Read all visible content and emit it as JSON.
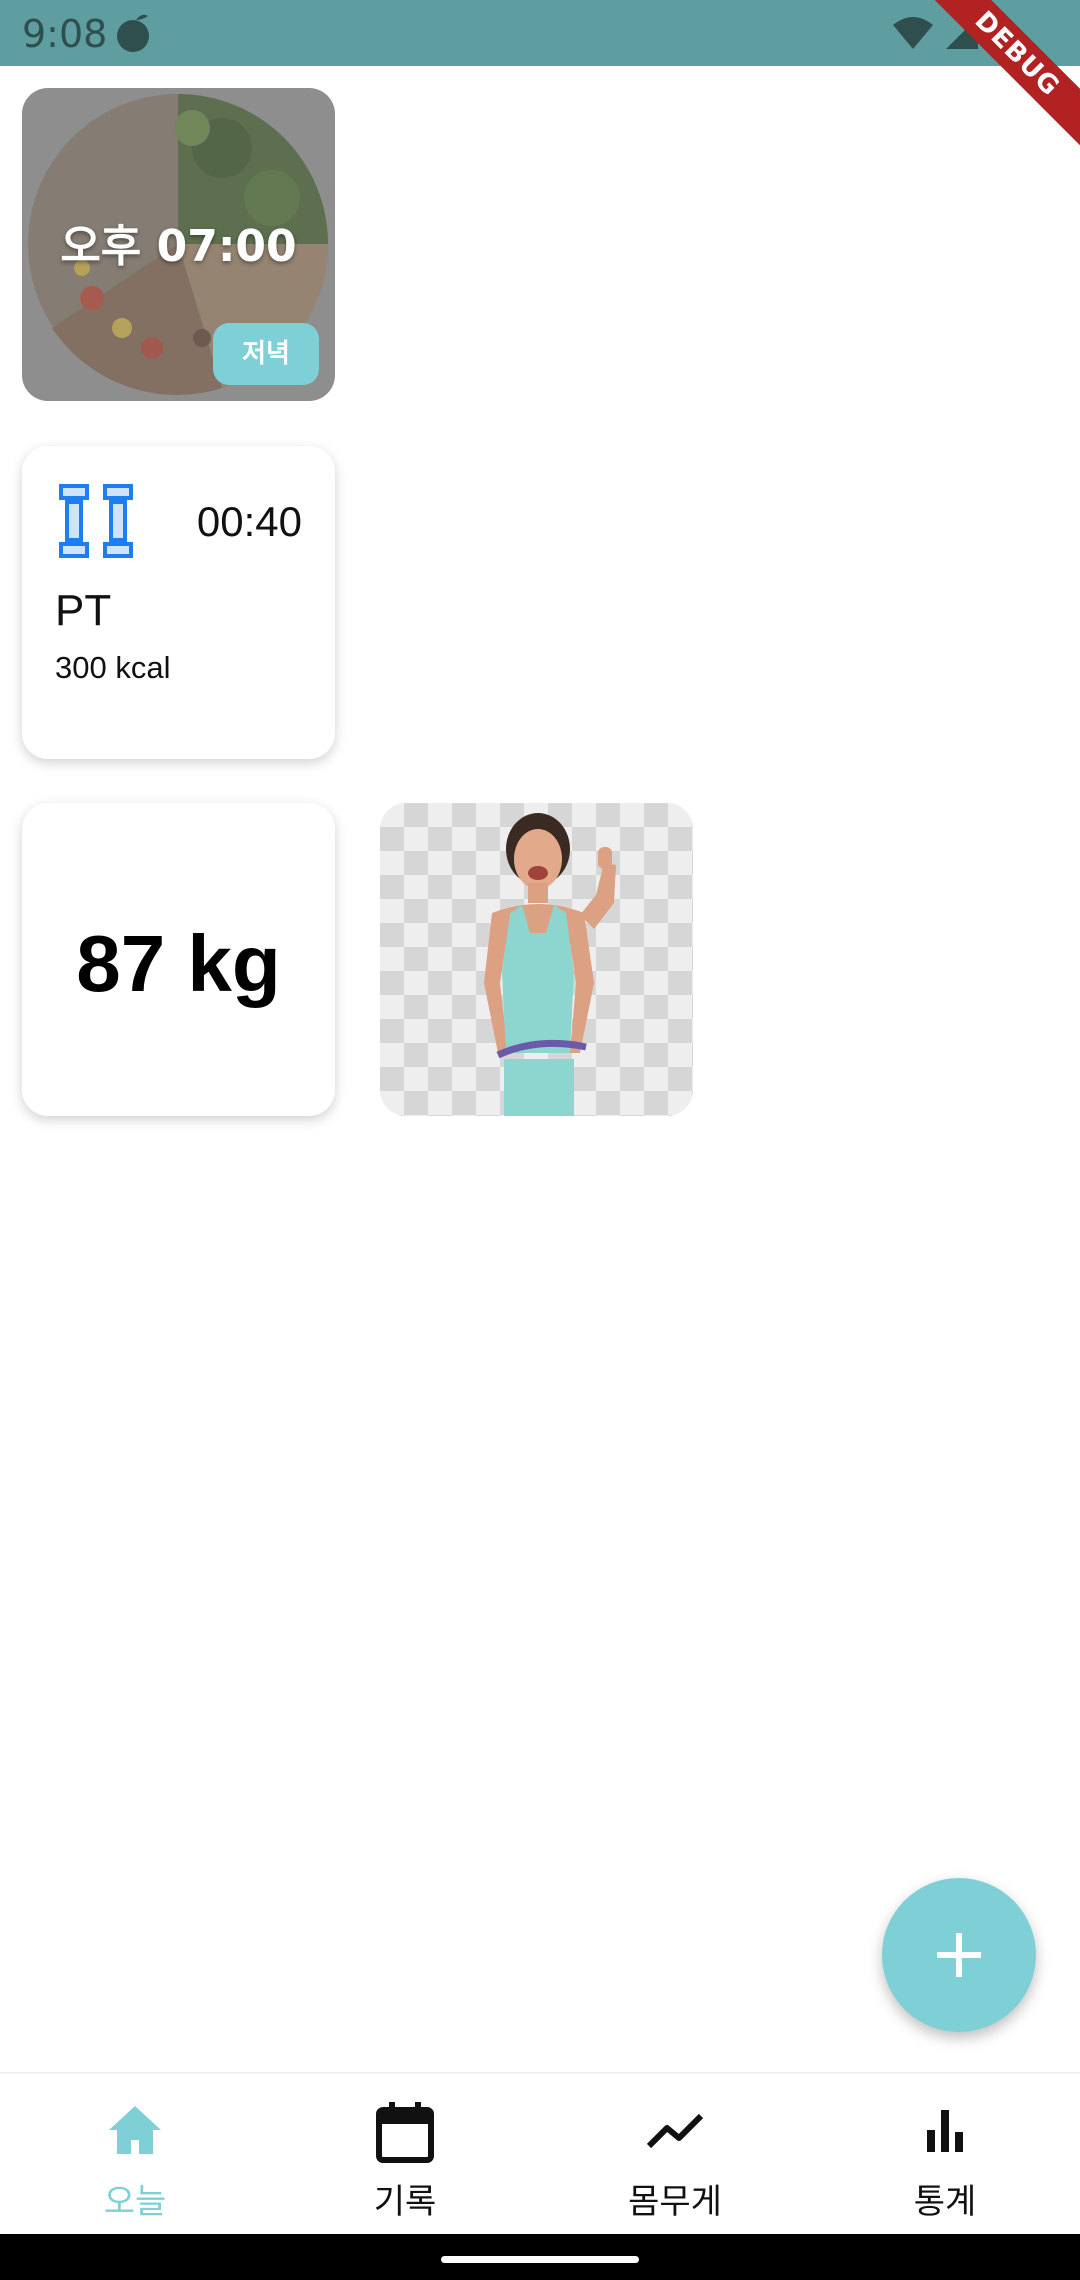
{
  "status_bar": {
    "time": "9:08",
    "icons": [
      "app-icon",
      "wifi-icon",
      "signal-icon",
      "battery-icon"
    ],
    "debug_label": "DEBUG"
  },
  "meal_card": {
    "time": "오후 07:00",
    "meal_type": "저녁"
  },
  "exercise_card": {
    "icon": "dumbbell-icon",
    "duration": "00:40",
    "name": "PT",
    "calories": "300 kcal"
  },
  "weight_card": {
    "value": "87 kg"
  },
  "photo_card": {
    "icon": "body-photo"
  },
  "fab": {
    "icon": "plus-icon"
  },
  "bottom_nav": {
    "items": [
      {
        "label": "오늘",
        "icon": "home-icon",
        "active": true
      },
      {
        "label": "기록",
        "icon": "calendar-icon",
        "active": false
      },
      {
        "label": "몸무게",
        "icon": "trend-line-icon",
        "active": false
      },
      {
        "label": "통계",
        "icon": "bar-chart-icon",
        "active": false
      }
    ]
  },
  "colors": {
    "status_bar": "#5f9ea0",
    "accent": "#7fd0d6",
    "debug_ribbon": "#b22222",
    "dumbbell": "#1e7ef0"
  }
}
